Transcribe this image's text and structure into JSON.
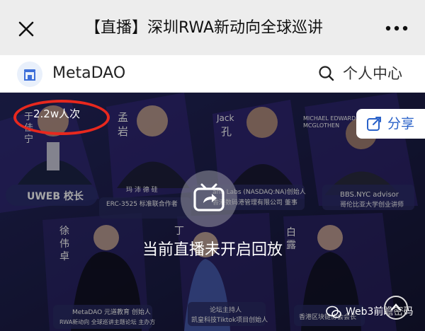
{
  "topbar": {
    "title": "【直播】深圳RWA新动向全球巡讲",
    "close_icon": "close-icon",
    "more_icon": "more-dots-icon"
  },
  "site": {
    "brand": "MetaDAO",
    "center_label": "个人中心",
    "logo_icon": "store-logo-icon",
    "search_icon": "search-icon"
  },
  "video": {
    "viewers": "2.2w人次",
    "share_label": "分享",
    "status": "当前直播未开启回放",
    "panel_names": {
      "p1": "UWEB 校长",
      "p1_vertical": [
        "于",
        "佳",
        "宁"
      ],
      "p2_vertical": [
        "孟",
        "岩"
      ],
      "p2_line1": "玛 沛 德 硅",
      "p2_line2": "ERC-3525 标准联合作者",
      "p3_small": "Jack",
      "p3_vertical": "孔",
      "p3_line1": "ano Labs (NASDAQ:NA)创始人",
      "p3_line2": "香港数码港管理有限公司 董事",
      "p4_small": "MICHAEL EDWARD",
      "p4_small2": "MCGLOTHEN",
      "p4_line1": "BBS.NYC advisor",
      "p4_line2": "哥伦比亚大学创业讲师",
      "p5_vertical": [
        "徐",
        "伟",
        "卓"
      ],
      "p5_line1": "MetaDAO 元道教育 创始人",
      "p5_line2": "RWA新动向 全球巡讲主题论坛 主办方",
      "p6_vertical": "丁",
      "p6_line1": "论坛主持人",
      "p6_line2": "凯皇科技Tiktok项目创始人",
      "p7_vertical": [
        "白",
        "露"
      ],
      "p7_line1": "香港区块链协会会长"
    },
    "watermark": "Web3前瞻密码"
  }
}
